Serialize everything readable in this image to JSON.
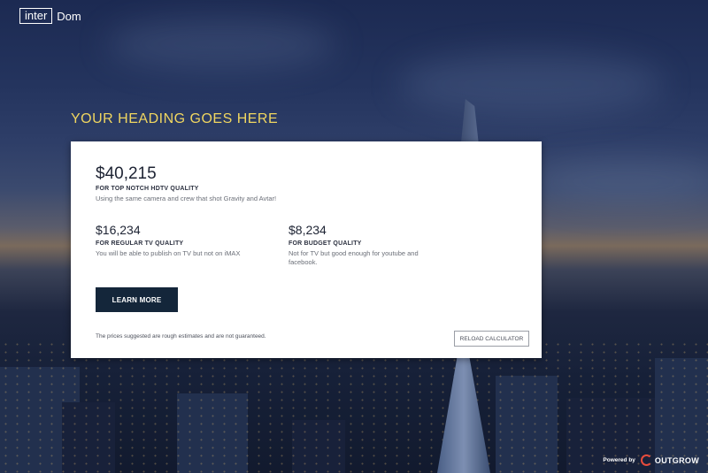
{
  "logo": {
    "box": "inter",
    "rest": "Dom"
  },
  "heading": "YOUR HEADING GOES HERE",
  "result": {
    "main": {
      "price": "$40,215",
      "label": "FOR TOP NOTCH HDTV QUALITY",
      "description": "Using the same camera and crew that shot Gravity and Avtar!"
    },
    "regular": {
      "price": "$16,234",
      "label": "FOR REGULAR TV QUALITY",
      "description": "You will be able to publish on TV but not on iMAX"
    },
    "budget": {
      "price": "$8,234",
      "label": "FOR BUDGET QUALITY",
      "description": "Not for TV but good enough for youtube and facebook."
    },
    "learn_more": "LEARN MORE",
    "disclaimer": "The prices suggested are rough estimates and are not guaranteed.",
    "reload": "RELOAD CALCULATOR"
  },
  "footer": {
    "powered_by": "Powered by",
    "brand": "OUTGROW",
    "brand_color": "#e74c3c"
  },
  "colors": {
    "heading": "#f0d660",
    "button": "#14263a"
  }
}
